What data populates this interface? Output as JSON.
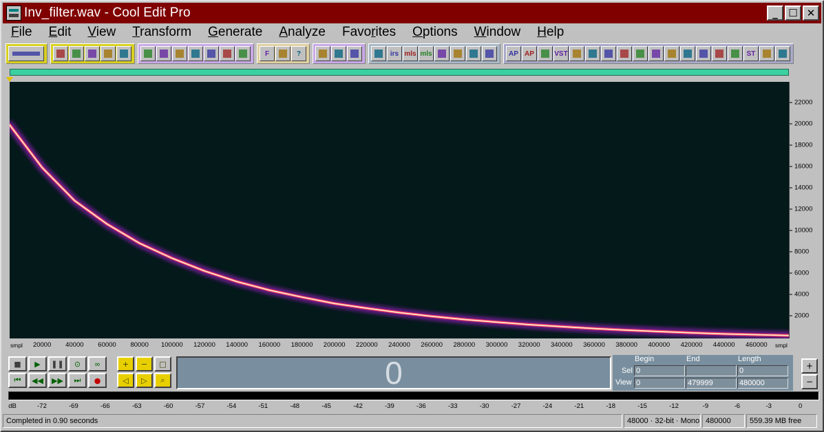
{
  "window": {
    "title": "Inv_filter.wav - Cool Edit Pro",
    "buttons": [
      "_",
      "☐",
      "✕"
    ]
  },
  "menu": [
    {
      "label": "File",
      "key": "F"
    },
    {
      "label": "Edit",
      "key": "E"
    },
    {
      "label": "View",
      "key": "V"
    },
    {
      "label": "Transform",
      "key": "T"
    },
    {
      "label": "Generate",
      "key": "G"
    },
    {
      "label": "Analyze",
      "key": "A"
    },
    {
      "label": "Favorites",
      "key": "r"
    },
    {
      "label": "Options",
      "key": "O"
    },
    {
      "label": "Window",
      "key": "W"
    },
    {
      "label": "Help",
      "key": "H"
    }
  ],
  "toolbar": {
    "groups": [
      [
        "waveform-view-icon"
      ],
      [
        "new-file-icon",
        "open-file-icon",
        "save-icon",
        "save-as-icon",
        "save-all-icon"
      ],
      [
        "cut-icon",
        "copy-icon",
        "paste-icon",
        "paste-new-icon",
        "mix-paste-icon",
        "trim-icon",
        "cd-icon"
      ],
      [
        "favorites-icon",
        "script-icon",
        "help-icon"
      ],
      [
        "spectral-view-icon",
        "zoom-sel-icon",
        "zoom-full-icon"
      ],
      [
        "stats-icon",
        "irs-icon",
        "mls-icon",
        "mls2-icon",
        "vu-icon",
        "script2-icon",
        "envelope-icon",
        "mark-icon"
      ],
      [
        "ap-icon",
        "ap2-icon",
        "echo-icon",
        "vst-icon",
        "cross-icon",
        "sweep-icon",
        "noise-icon",
        "tf-icon",
        "eq-icon",
        "pitch-icon",
        "chorus-icon",
        "stereo-icon",
        "bomb-icon",
        "amp-icon",
        "dot-icon",
        "st-icon",
        "sine-icon",
        "brain-icon"
      ]
    ],
    "labels": {
      "favorites-icon": "F",
      "help-icon": "?",
      "irs-icon": "irs",
      "mls-icon": "mls",
      "mls2-icon": "mls",
      "ap-icon": "AP",
      "ap2-icon": "AP",
      "st-icon": "ST",
      "vst-icon": "VST"
    }
  },
  "spectrogram": {
    "y_ticks": [
      "22000",
      "20000",
      "18000",
      "16000",
      "14000",
      "12000",
      "10000",
      "8000",
      "6000",
      "4000",
      "2000"
    ],
    "x_unit": "smpl",
    "x_ticks": [
      "20000",
      "40000",
      "60000",
      "80000",
      "100000",
      "120000",
      "140000",
      "160000",
      "180000",
      "200000",
      "220000",
      "240000",
      "260000",
      "280000",
      "300000",
      "320000",
      "340000",
      "360000",
      "380000",
      "400000",
      "420000",
      "440000",
      "460000"
    ]
  },
  "chart_data": {
    "type": "line",
    "x": [
      0,
      20000,
      40000,
      60000,
      80000,
      100000,
      120000,
      140000,
      160000,
      180000,
      200000,
      220000,
      240000,
      260000,
      280000,
      300000,
      320000,
      340000,
      360000,
      380000,
      400000,
      420000,
      440000,
      460000,
      479999
    ],
    "values": [
      19900,
      15900,
      12800,
      10600,
      8800,
      7400,
      6200,
      5200,
      4400,
      3750,
      3150,
      2700,
      2300,
      1950,
      1650,
      1400,
      1170,
      980,
      800,
      650,
      520,
      400,
      300,
      220,
      150
    ],
    "xlim": [
      0,
      480000
    ],
    "ylim": [
      0,
      24000
    ],
    "xlabel": "smpl",
    "colors": {
      "background": "#03191a",
      "glow": "#6a1a8a",
      "line": "#ff4060",
      "core": "#fff4d0"
    }
  },
  "transport": {
    "buttons": [
      "stop-icon",
      "play-icon",
      "pause-icon",
      "play-to-end-icon",
      "loop-icon",
      "goto-start-icon",
      "rewind-icon",
      "fast-forward-icon",
      "goto-end-icon",
      "record-icon"
    ],
    "glyphs": [
      "■",
      "▶",
      "❚❚",
      "⊙",
      "∞",
      "⏮",
      "◀◀",
      "▶▶",
      "⏭",
      "●"
    ]
  },
  "zoom": {
    "buttons": [
      "zoom-in-icon",
      "zoom-out-icon",
      "zoom-full-icon",
      "zoom-left-icon",
      "zoom-right-icon",
      "zoom-selection-icon"
    ],
    "glyphs": [
      "+",
      "−",
      "□",
      "◁",
      "▷",
      "⌕"
    ]
  },
  "time_display": "0",
  "selection": {
    "headers": {
      "begin": "Begin",
      "end": "End",
      "length": "Length"
    },
    "sel": {
      "label": "Sel",
      "begin": "0",
      "end": "",
      "length": "0"
    },
    "view": {
      "label": "View",
      "begin": "0",
      "end": "479999",
      "length": "480000"
    }
  },
  "level_meter": {
    "unit": "dB",
    "ticks": [
      "-72",
      "-69",
      "-66",
      "-63",
      "-60",
      "-57",
      "-54",
      "-51",
      "-48",
      "-45",
      "-42",
      "-39",
      "-36",
      "-33",
      "-30",
      "-27",
      "-24",
      "-21",
      "-18",
      "-15",
      "-12",
      "-9",
      "-6",
      "-3",
      "0"
    ]
  },
  "status": {
    "message": "Completed in 0.90 seconds",
    "format": "48000 · 32-bit · Mono",
    "samples": "480000",
    "free": "559.39 MB free"
  }
}
